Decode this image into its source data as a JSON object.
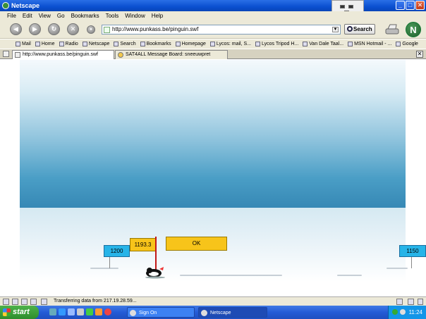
{
  "window": {
    "title": "Netscape",
    "controls": {
      "minimize": "_",
      "maximize": "□",
      "close": "✕"
    }
  },
  "menu": [
    "File",
    "Edit",
    "View",
    "Go",
    "Bookmarks",
    "Tools",
    "Window",
    "Help"
  ],
  "navbar": {
    "url": "http://www.punkass.be/pinguin.swf",
    "search_label": "Search",
    "logo_letter": "N",
    "buttons": [
      "back-icon",
      "forward-icon",
      "reload-icon",
      "stop-icon"
    ]
  },
  "bookmarks": [
    "Mail",
    "Home",
    "Radio",
    "Netscape",
    "Search",
    "Bookmarks",
    "Homepage",
    "Lycos: mail, S...",
    "Lycos Tripod H...",
    "Van Dale Taal...",
    "MSN Hotmail - ...",
    "Google"
  ],
  "tabs": [
    {
      "label": "http://www.punkass.be/pinguin.swf"
    },
    {
      "label": "SAT4ALL Message Board: sneeuwpret"
    }
  ],
  "game": {
    "sign_left": "1200",
    "sign_right": "1150",
    "distance": "1193.3",
    "ok_label": "OK"
  },
  "status": {
    "text": "Transferring data from 217.19.28.59..."
  },
  "taskbar": {
    "start": "start",
    "items": [
      "Sign On",
      "Netscape"
    ],
    "clock": "11:24"
  },
  "colors": {
    "sky_top": "#f4f9fc",
    "sky_bottom": "#3688b5",
    "sign_blue": "#27b4e8",
    "ok_yellow": "#f7c41a",
    "marker_red": "#c21818"
  }
}
